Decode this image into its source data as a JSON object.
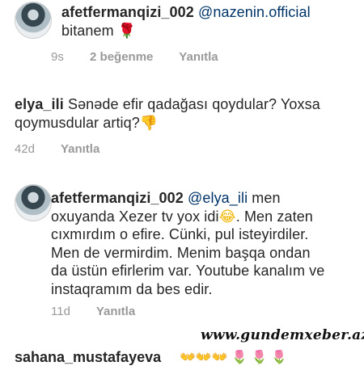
{
  "comments": [
    {
      "username": "afetfermanqizi_002",
      "mention": "@nazenin.official",
      "text_line2": "bitanem",
      "emoji": "🌹",
      "time": "9s",
      "likes": "2 beğenme",
      "reply": "Yanıtla"
    },
    {
      "username": "elya_ili",
      "text_line1": "Sənəde efir qadağası qoydular? Yoxsa",
      "text_line2": "qoymusdular artiq?",
      "emoji": "👎",
      "time": "42d",
      "reply": "Yanıtla"
    },
    {
      "username": "afetfermanqizi_002",
      "mention": "@elya_ili",
      "text_line1_tail": "men",
      "text_line2": "oxuyanda Xezer tv yox idi",
      "emoji": "😂",
      "text_line2_tail": ". Men zaten",
      "text_line3": "cıxmırdım o efire. Cünki, pul isteyirdiler.",
      "text_line4": "Men de vermirdim. Menim başqa ondan",
      "text_line5": "da üstün efirlerim var. Youtube kanalım ve",
      "text_line6": "instaqramım da bes edir.",
      "time": "11d",
      "reply": "Yanıtla"
    },
    {
      "username": "sahana_mustafayeva",
      "emojis_hands": "👐👐👐",
      "emojis_tulips": "🌷 🌷 🌷"
    }
  ],
  "watermark": "www.gundemxeber.az"
}
